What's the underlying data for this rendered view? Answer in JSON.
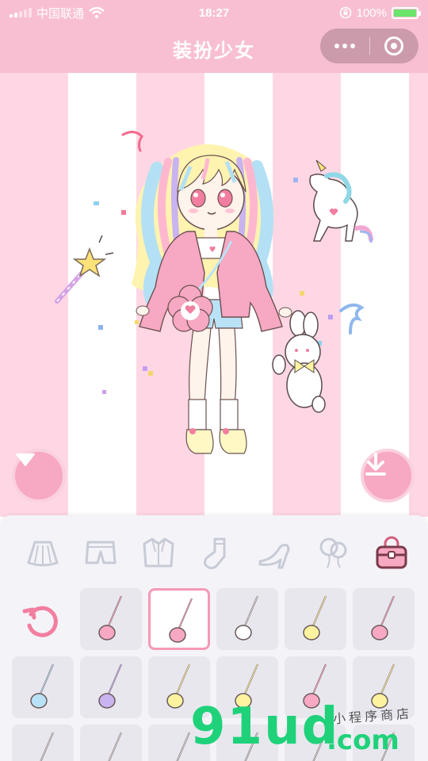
{
  "status_bar": {
    "carrier": "中国联通",
    "time": "18:27",
    "battery_percent": "100%",
    "battery_level": 1.0
  },
  "navbar": {
    "title": "装扮少女",
    "more_icon": "more-dots-icon",
    "close_icon": "capsule-close-icon"
  },
  "stage": {
    "background_colors": [
      "#ffd7e4",
      "#ffffff"
    ],
    "collapse_button_icon": "triangle-down-icon",
    "download_button_icon": "download-icon"
  },
  "categories": [
    {
      "name": "skirt",
      "icon": "skirt-icon",
      "selected": false
    },
    {
      "name": "shorts",
      "icon": "shorts-icon",
      "selected": false
    },
    {
      "name": "jacket",
      "icon": "jacket-icon",
      "selected": false
    },
    {
      "name": "socks",
      "icon": "sock-icon",
      "selected": false
    },
    {
      "name": "shoes",
      "icon": "high-heel-icon",
      "selected": false
    },
    {
      "name": "balloons",
      "icon": "balloons-icon",
      "selected": false
    },
    {
      "name": "bags",
      "icon": "handbag-icon",
      "selected": true
    }
  ],
  "items": [
    {
      "icon": "bear-bag-icon",
      "selected": false
    },
    {
      "icon": "flower-bag-icon",
      "selected": true
    },
    {
      "icon": "plain-strap-icon",
      "selected": false
    },
    {
      "icon": "cat-bag-icon",
      "selected": false
    },
    {
      "icon": "pig-bag-icon",
      "selected": false
    },
    {
      "icon": "blue-pouch-icon",
      "selected": false
    },
    {
      "icon": "striped-bottle-icon",
      "selected": false
    },
    {
      "icon": "milk-carton-icon",
      "selected": false
    },
    {
      "icon": "bow-clip-icon",
      "selected": false
    },
    {
      "icon": "flower-charm-icon",
      "selected": false
    },
    {
      "icon": "heart-bag-icon",
      "selected": false
    },
    {
      "icon": "bunny-bag-icon",
      "selected": false
    },
    {
      "icon": "strap-icon",
      "selected": false
    },
    {
      "icon": "strap-icon",
      "selected": false
    },
    {
      "icon": "strap-icon",
      "selected": false
    },
    {
      "icon": "strap-icon",
      "selected": false
    },
    {
      "icon": "strap-icon",
      "selected": false
    },
    {
      "icon": "strap-icon",
      "selected": false
    }
  ],
  "reset_icon": "reset-arrow-icon",
  "watermark": {
    "main": "91ud",
    "domain": ".com",
    "subtitle": "小程序商店"
  },
  "colors": {
    "accent_pink": "#f7a8c2",
    "nav_pink": "#f8bfd2",
    "selected_border": "#f59ab6",
    "panel_bg": "#f4f3f8",
    "watermark_green": "#1fd27a"
  }
}
